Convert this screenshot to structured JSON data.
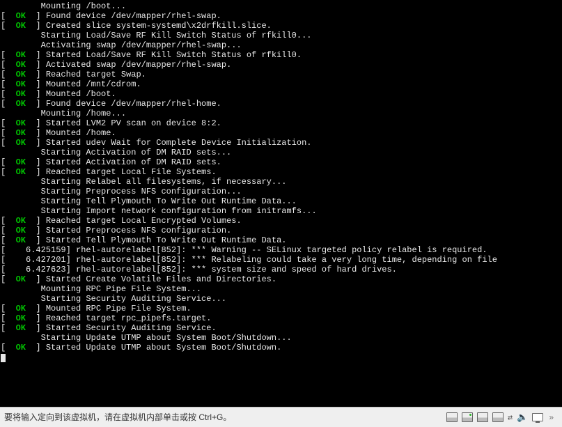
{
  "boot": {
    "ok": "OK",
    "lines": [
      {
        "indent": 1,
        "segments": [
          {
            "s": "white",
            "t": "        Mounting /boot..."
          }
        ]
      },
      {
        "indent": 0,
        "segments": [
          {
            "s": "white",
            "t": "[  "
          },
          {
            "s": "green",
            "t": "OK"
          },
          {
            "s": "white",
            "t": "  ] Found device /dev/mapper/rhel-swap."
          }
        ]
      },
      {
        "indent": 0,
        "segments": [
          {
            "s": "white",
            "t": "[  "
          },
          {
            "s": "green",
            "t": "OK"
          },
          {
            "s": "white",
            "t": "  ] Created slice system-systemd\\x2drfkill.slice."
          }
        ]
      },
      {
        "indent": 1,
        "segments": [
          {
            "s": "white",
            "t": "        Starting Load/Save RF Kill Switch Status of rfkill0..."
          }
        ]
      },
      {
        "indent": 1,
        "segments": [
          {
            "s": "white",
            "t": "        Activating swap /dev/mapper/rhel-swap..."
          }
        ]
      },
      {
        "indent": 0,
        "segments": [
          {
            "s": "white",
            "t": "[  "
          },
          {
            "s": "green",
            "t": "OK"
          },
          {
            "s": "white",
            "t": "  ] Started Load/Save RF Kill Switch Status of rfkill0."
          }
        ]
      },
      {
        "indent": 0,
        "segments": [
          {
            "s": "white",
            "t": "[  "
          },
          {
            "s": "green",
            "t": "OK"
          },
          {
            "s": "white",
            "t": "  ] Activated swap /dev/mapper/rhel-swap."
          }
        ]
      },
      {
        "indent": 0,
        "segments": [
          {
            "s": "white",
            "t": "[  "
          },
          {
            "s": "green",
            "t": "OK"
          },
          {
            "s": "white",
            "t": "  ] Reached target Swap."
          }
        ]
      },
      {
        "indent": 0,
        "segments": [
          {
            "s": "white",
            "t": "[  "
          },
          {
            "s": "green",
            "t": "OK"
          },
          {
            "s": "white",
            "t": "  ] Mounted /mnt/cdrom."
          }
        ]
      },
      {
        "indent": 0,
        "segments": [
          {
            "s": "white",
            "t": "[  "
          },
          {
            "s": "green",
            "t": "OK"
          },
          {
            "s": "white",
            "t": "  ] Mounted /boot."
          }
        ]
      },
      {
        "indent": 0,
        "segments": [
          {
            "s": "white",
            "t": "[  "
          },
          {
            "s": "green",
            "t": "OK"
          },
          {
            "s": "white",
            "t": "  ] Found device /dev/mapper/rhel-home."
          }
        ]
      },
      {
        "indent": 1,
        "segments": [
          {
            "s": "white",
            "t": "        Mounting /home..."
          }
        ]
      },
      {
        "indent": 0,
        "segments": [
          {
            "s": "white",
            "t": "[  "
          },
          {
            "s": "green",
            "t": "OK"
          },
          {
            "s": "white",
            "t": "  ] Started LVM2 PV scan on device 8:2."
          }
        ]
      },
      {
        "indent": 0,
        "segments": [
          {
            "s": "white",
            "t": "[  "
          },
          {
            "s": "green",
            "t": "OK"
          },
          {
            "s": "white",
            "t": "  ] Mounted /home."
          }
        ]
      },
      {
        "indent": 0,
        "segments": [
          {
            "s": "white",
            "t": "[  "
          },
          {
            "s": "green",
            "t": "OK"
          },
          {
            "s": "white",
            "t": "  ] Started udev Wait for Complete Device Initialization."
          }
        ]
      },
      {
        "indent": 1,
        "segments": [
          {
            "s": "white",
            "t": "        Starting Activation of DM RAID sets..."
          }
        ]
      },
      {
        "indent": 0,
        "segments": [
          {
            "s": "white",
            "t": "[  "
          },
          {
            "s": "green",
            "t": "OK"
          },
          {
            "s": "white",
            "t": "  ] Started Activation of DM RAID sets."
          }
        ]
      },
      {
        "indent": 0,
        "segments": [
          {
            "s": "white",
            "t": "[  "
          },
          {
            "s": "green",
            "t": "OK"
          },
          {
            "s": "white",
            "t": "  ] Reached target Local File Systems."
          }
        ]
      },
      {
        "indent": 1,
        "segments": [
          {
            "s": "white",
            "t": "        Starting Relabel all filesystems, if necessary..."
          }
        ]
      },
      {
        "indent": 1,
        "segments": [
          {
            "s": "white",
            "t": "        Starting Preprocess NFS configuration..."
          }
        ]
      },
      {
        "indent": 1,
        "segments": [
          {
            "s": "white",
            "t": "        Starting Tell Plymouth To Write Out Runtime Data..."
          }
        ]
      },
      {
        "indent": 1,
        "segments": [
          {
            "s": "white",
            "t": "        Starting Import network configuration from initramfs..."
          }
        ]
      },
      {
        "indent": 0,
        "segments": [
          {
            "s": "white",
            "t": "[  "
          },
          {
            "s": "green",
            "t": "OK"
          },
          {
            "s": "white",
            "t": "  ] Reached target Local Encrypted Volumes."
          }
        ]
      },
      {
        "indent": 0,
        "segments": [
          {
            "s": "white",
            "t": "[  "
          },
          {
            "s": "green",
            "t": "OK"
          },
          {
            "s": "white",
            "t": "  ] Started Preprocess NFS configuration."
          }
        ]
      },
      {
        "indent": 0,
        "segments": [
          {
            "s": "white",
            "t": "[  "
          },
          {
            "s": "green",
            "t": "OK"
          },
          {
            "s": "white",
            "t": "  ] Started Tell Plymouth To Write Out Runtime Data."
          }
        ]
      },
      {
        "indent": 0,
        "segments": [
          {
            "s": "white",
            "t": "[    6.425159] rhel-autorelabel[852]: *** Warning -- SELinux targeted policy relabel is required."
          }
        ]
      },
      {
        "indent": 0,
        "segments": [
          {
            "s": "white",
            "t": "[    6.427201] rhel-autorelabel[852]: *** Relabeling could take a very long time, depending on file"
          }
        ]
      },
      {
        "indent": 0,
        "segments": [
          {
            "s": "white",
            "t": "[    6.427623] rhel-autorelabel[852]: *** system size and speed of hard drives."
          }
        ]
      },
      {
        "indent": 0,
        "segments": [
          {
            "s": "white",
            "t": "[  "
          },
          {
            "s": "green",
            "t": "OK"
          },
          {
            "s": "white",
            "t": "  ] Started Create Volatile Files and Directories."
          }
        ]
      },
      {
        "indent": 1,
        "segments": [
          {
            "s": "white",
            "t": "        Mounting RPC Pipe File System..."
          }
        ]
      },
      {
        "indent": 1,
        "segments": [
          {
            "s": "white",
            "t": "        Starting Security Auditing Service..."
          }
        ]
      },
      {
        "indent": 0,
        "segments": [
          {
            "s": "white",
            "t": "[  "
          },
          {
            "s": "green",
            "t": "OK"
          },
          {
            "s": "white",
            "t": "  ] Mounted RPC Pipe File System."
          }
        ]
      },
      {
        "indent": 0,
        "segments": [
          {
            "s": "white",
            "t": "[  "
          },
          {
            "s": "green",
            "t": "OK"
          },
          {
            "s": "white",
            "t": "  ] Reached target rpc_pipefs.target."
          }
        ]
      },
      {
        "indent": 0,
        "segments": [
          {
            "s": "white",
            "t": "[  "
          },
          {
            "s": "green",
            "t": "OK"
          },
          {
            "s": "white",
            "t": "  ] Started Security Auditing Service."
          }
        ]
      },
      {
        "indent": 1,
        "segments": [
          {
            "s": "white",
            "t": "        Starting Update UTMP about System Boot/Shutdown..."
          }
        ]
      },
      {
        "indent": 0,
        "segments": [
          {
            "s": "white",
            "t": "[  "
          },
          {
            "s": "green",
            "t": "OK"
          },
          {
            "s": "white",
            "t": "  ] Started Update UTMP about System Boot/Shutdown."
          }
        ]
      }
    ]
  },
  "statusbar": {
    "message": "要将输入定向到该虚拟机，请在虚拟机内部单击或按 Ctrl+G。",
    "tray_icons": [
      "disk-icon",
      "disk-icon",
      "disk-icon",
      "disk-icon",
      "net-icon",
      "speaker-icon",
      "screen-icon",
      "chev-icon"
    ]
  },
  "colors": {
    "ok_green": "#00c000",
    "text": "#e8e8e8",
    "bg": "#000000",
    "status_bg": "#efefef",
    "status_text": "#333333"
  }
}
